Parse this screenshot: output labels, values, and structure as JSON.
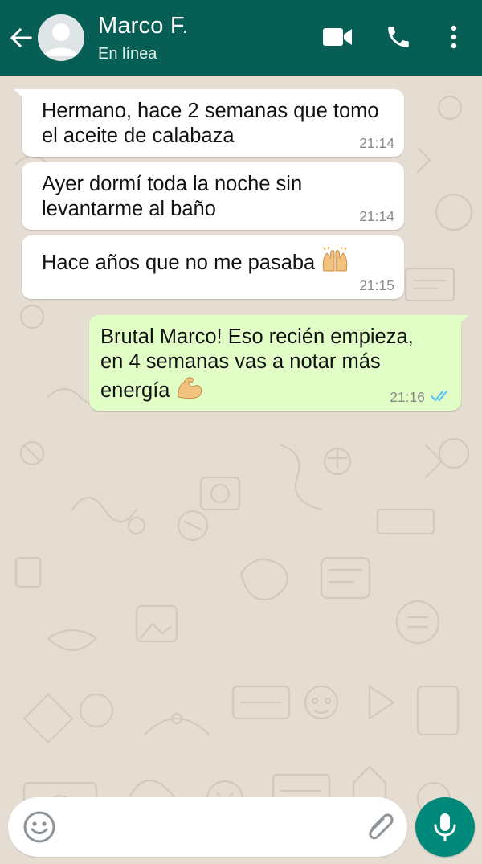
{
  "header": {
    "contact_name": "Marco F.",
    "status": "En línea",
    "background_color": "#075e54",
    "icons": [
      "back-arrow-icon",
      "video-call-icon",
      "phone-icon",
      "more-vertical-icon"
    ]
  },
  "messages": [
    {
      "direction": "incoming",
      "lines": [
        "Hermano, hace 2 semanas que tomo",
        "el aceite de calabaza"
      ],
      "time": "21:14"
    },
    {
      "direction": "incoming",
      "lines": [
        "Ayer dormí toda la noche sin",
        "levantarme al baño"
      ],
      "time": "21:14"
    },
    {
      "direction": "incoming",
      "lines": [
        "Hace años que no me pasaba"
      ],
      "emoji": "raising-hands-emoji",
      "time": "21:15"
    },
    {
      "direction": "outgoing",
      "lines": [
        "Brutal Marco! Eso recién empieza,",
        "en 4 semanas vas a notar más",
        "energía"
      ],
      "emoji": "flexed-biceps-emoji",
      "time": "21:16",
      "read_receipt": "double-check-read-icon"
    }
  ],
  "composer": {
    "placeholder": "",
    "icons": [
      "emoji-icon",
      "attach-icon",
      "mic-icon"
    ]
  },
  "colors": {
    "incoming_bubble": "#ffffff",
    "outgoing_bubble": "#e1fec6",
    "wallpaper": "#e6ddd2",
    "mic_button": "#00897b",
    "read_tick": "#4fc3f7"
  }
}
